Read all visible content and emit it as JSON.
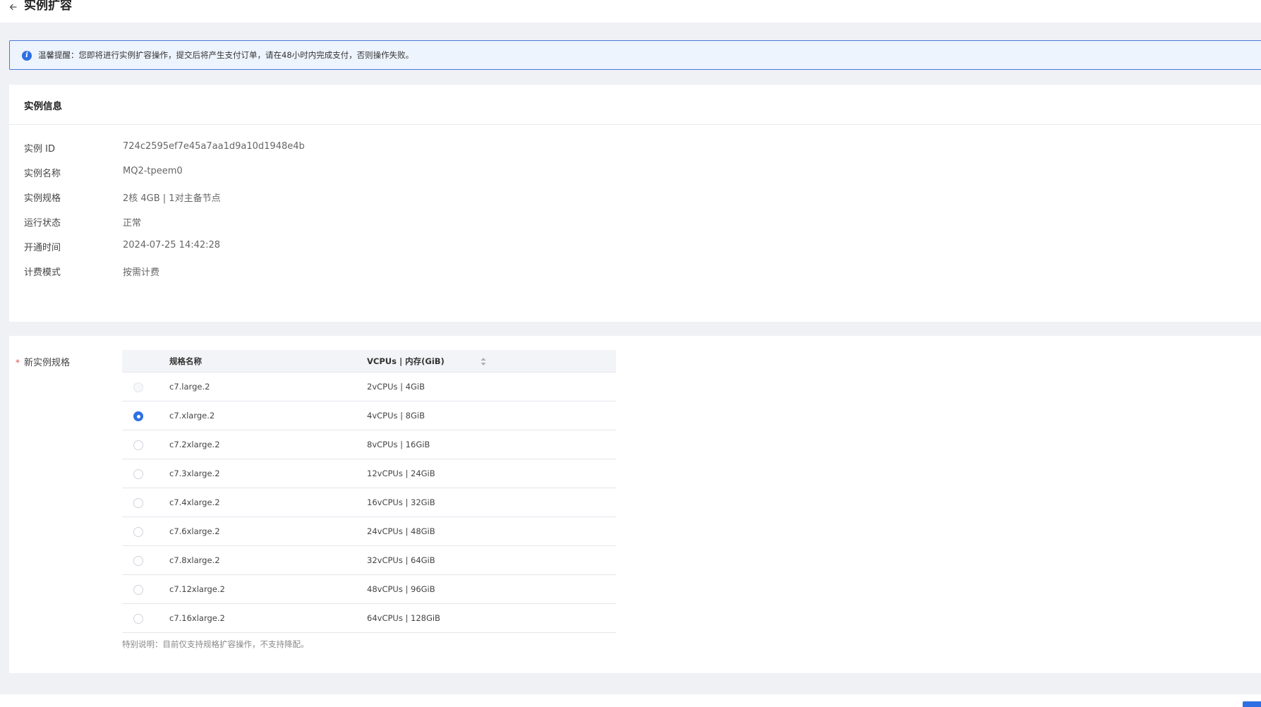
{
  "header": {
    "title": "实例扩容",
    "back_icon": "arrow-left-icon"
  },
  "alert": {
    "icon": "info-icon",
    "icon_glyph": "i",
    "text": "温馨提醒：您即将进行实例扩容操作，提交后将产生支付订单，请在48小时内完成支付，否则操作失败。"
  },
  "instance_info": {
    "title": "实例信息",
    "rows": [
      {
        "label": "实例 ID",
        "value": "724c2595ef7e45a7aa1d9a10d1948e4b"
      },
      {
        "label": "实例名称",
        "value": "MQ2-tpeem0"
      },
      {
        "label": "实例规格",
        "value": "2核 4GB | 1对主备节点"
      },
      {
        "label": "运行状态",
        "value": "正常"
      },
      {
        "label": "开通时间",
        "value": "2024-07-25 14:42:28"
      },
      {
        "label": "计费模式",
        "value": "按需计费"
      }
    ]
  },
  "new_spec": {
    "required_mark": "*",
    "label": "新实例规格",
    "columns": {
      "name": "规格名称",
      "resources": "VCPUs | 内存(GiB)"
    },
    "rows": [
      {
        "name": "c7.large.2",
        "resources": "2vCPUs | 4GiB",
        "state": "disabled"
      },
      {
        "name": "c7.xlarge.2",
        "resources": "4vCPUs | 8GiB",
        "state": "checked"
      },
      {
        "name": "c7.2xlarge.2",
        "resources": "8vCPUs | 16GiB",
        "state": "unchecked"
      },
      {
        "name": "c7.3xlarge.2",
        "resources": "12vCPUs | 24GiB",
        "state": "unchecked"
      },
      {
        "name": "c7.4xlarge.2",
        "resources": "16vCPUs | 32GiB",
        "state": "unchecked"
      },
      {
        "name": "c7.6xlarge.2",
        "resources": "24vCPUs | 48GiB",
        "state": "unchecked"
      },
      {
        "name": "c7.8xlarge.2",
        "resources": "32vCPUs | 64GiB",
        "state": "unchecked"
      },
      {
        "name": "c7.12xlarge.2",
        "resources": "48vCPUs | 96GiB",
        "state": "unchecked"
      },
      {
        "name": "c7.16xlarge.2",
        "resources": "64vCPUs | 128GiB",
        "state": "unchecked"
      }
    ],
    "note": "特别说明：目前仅支持规格扩容操作，不支持降配。"
  },
  "colors": {
    "primary": "#2f6fe4",
    "required": "#e84b4b",
    "page_bg": "#eff1f5",
    "alert_bg": "#eef4fe",
    "alert_border": "#4a78d8"
  }
}
